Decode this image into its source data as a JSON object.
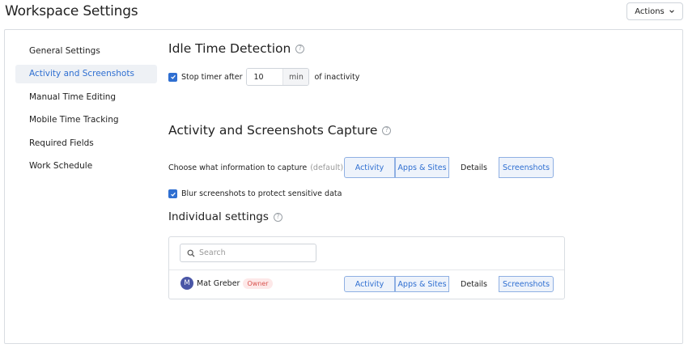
{
  "header": {
    "title": "Workspace Settings",
    "actions_label": "Actions"
  },
  "sidebar": {
    "items": [
      {
        "label": "General Settings"
      },
      {
        "label": "Activity and Screenshots",
        "active": true
      },
      {
        "label": "Manual Time Editing"
      },
      {
        "label": "Mobile Time Tracking"
      },
      {
        "label": "Required Fields"
      },
      {
        "label": "Work Schedule"
      }
    ]
  },
  "idle": {
    "title": "Idle Time Detection",
    "checkbox_checked": true,
    "stop_label": "Stop timer after",
    "value": "10",
    "unit": "min",
    "suffix": "of inactivity"
  },
  "capture": {
    "title": "Activity and Screenshots Capture",
    "choose_label": "Choose what information to capture",
    "default_label": "(default)",
    "options": [
      {
        "label": "Activity",
        "selected": true
      },
      {
        "label": "Apps & Sites",
        "selected": true
      },
      {
        "label": "Details",
        "selected": false
      },
      {
        "label": "Screenshots",
        "selected": true
      }
    ],
    "blur_checked": true,
    "blur_label": "Blur screenshots to protect sensitive data"
  },
  "individual": {
    "title": "Individual settings",
    "search_placeholder": "Search",
    "user": {
      "initial": "M",
      "name": "Mat Greber",
      "badge": "Owner",
      "options": [
        {
          "label": "Activity",
          "selected": true
        },
        {
          "label": "Apps & Sites",
          "selected": true
        },
        {
          "label": "Details",
          "selected": false
        },
        {
          "label": "Screenshots",
          "selected": true
        }
      ]
    }
  },
  "colors": {
    "accent": "#2f6fd1",
    "active_bg": "#eef1f5",
    "avatar": "#4a56a6",
    "owner_badge_text": "#d9534f"
  }
}
